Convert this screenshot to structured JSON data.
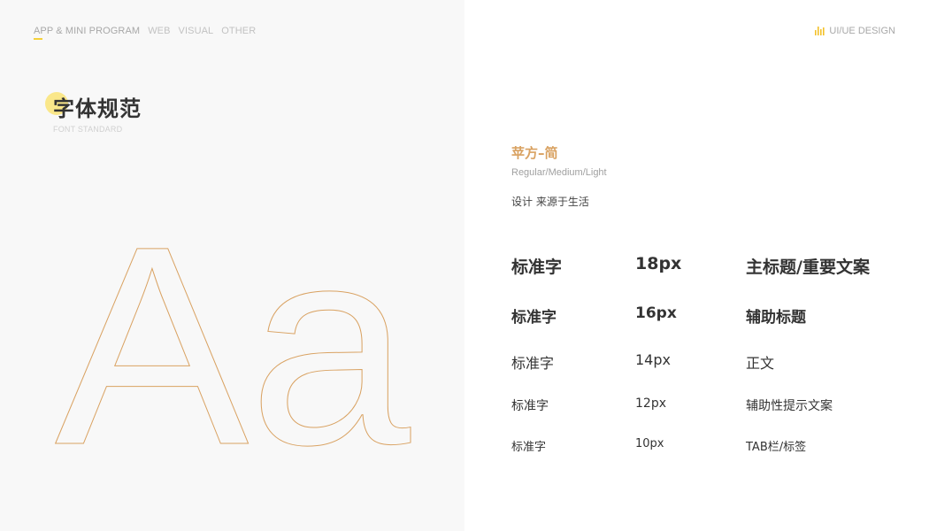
{
  "nav": {
    "items": [
      {
        "label": "APP & MINI PROGRAM",
        "active": true
      },
      {
        "label": "WEB",
        "active": false
      },
      {
        "label": "VISUAL",
        "active": false
      },
      {
        "label": "OTHER",
        "active": false
      }
    ],
    "underline_color": "#f4d13a"
  },
  "brand": {
    "label": "UI/UE DESIGN",
    "icon": "bars-logo-icon",
    "icon_color": "#f4c12a"
  },
  "title": {
    "main": "字体规范",
    "sub": "FONT STANDARD",
    "dot_color": "#fae78a"
  },
  "glyph": {
    "text": "Aa",
    "stroke_color": "#d9a262"
  },
  "font": {
    "name": "苹方–简",
    "weights": "Regular/Medium/Light",
    "sample": "设计 来源于生活",
    "name_color": "#d9a262"
  },
  "specs": [
    {
      "label": "标准字",
      "size": "18px",
      "usage": "主标题/重要文案"
    },
    {
      "label": "标准字",
      "size": "16px",
      "usage": "辅助标题"
    },
    {
      "label": "标准字",
      "size": "14px",
      "usage": "正文"
    },
    {
      "label": "标准字",
      "size": "12px",
      "usage": "辅助性提示文案"
    },
    {
      "label": "标准字",
      "size": "10px",
      "usage": "TAB栏/标签"
    }
  ]
}
